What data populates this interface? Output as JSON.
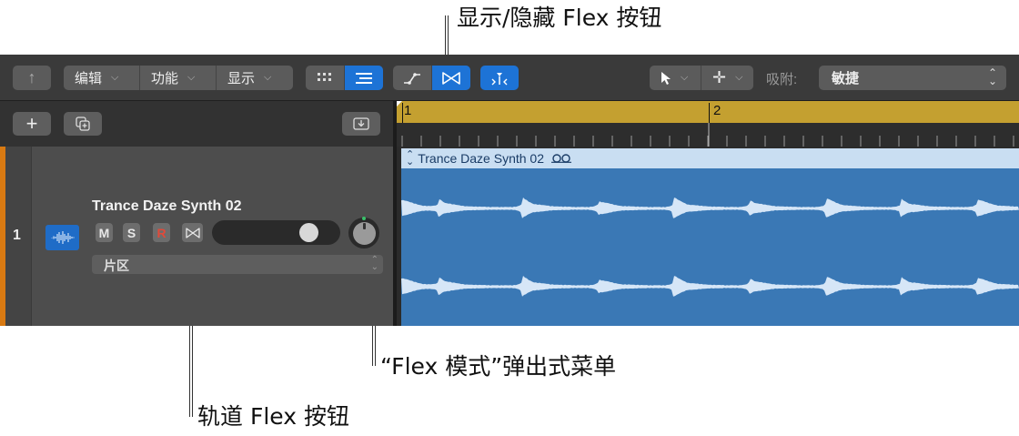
{
  "callouts": {
    "flex_toggle": "显示/隐藏 Flex 按钮",
    "flex_mode_menu": "“Flex 模式”弹出式菜单",
    "track_flex": "轨道 Flex 按钮"
  },
  "toolbar": {
    "up_icon": "↑",
    "edit_label": "编辑",
    "functions_label": "功能",
    "view_label": "显示",
    "snap_label": "吸附:",
    "snap_value": "敏捷"
  },
  "track_header": {
    "add_icon": "+",
    "track_number": "1",
    "track_name": "Trance Daze Synth 02",
    "mute_label": "M",
    "solo_label": "S",
    "record_label": "R",
    "flex_mode_value": "片区"
  },
  "ruler": {
    "bar1": "1",
    "bar2": "2"
  },
  "region": {
    "name": "Trance Daze Synth 02"
  },
  "colors": {
    "accent_blue": "#1d73d6",
    "cycle_gold": "#c4a030",
    "region_blue": "#3a78b5",
    "track_orange": "#d97a12"
  },
  "volume_level": 0.82
}
